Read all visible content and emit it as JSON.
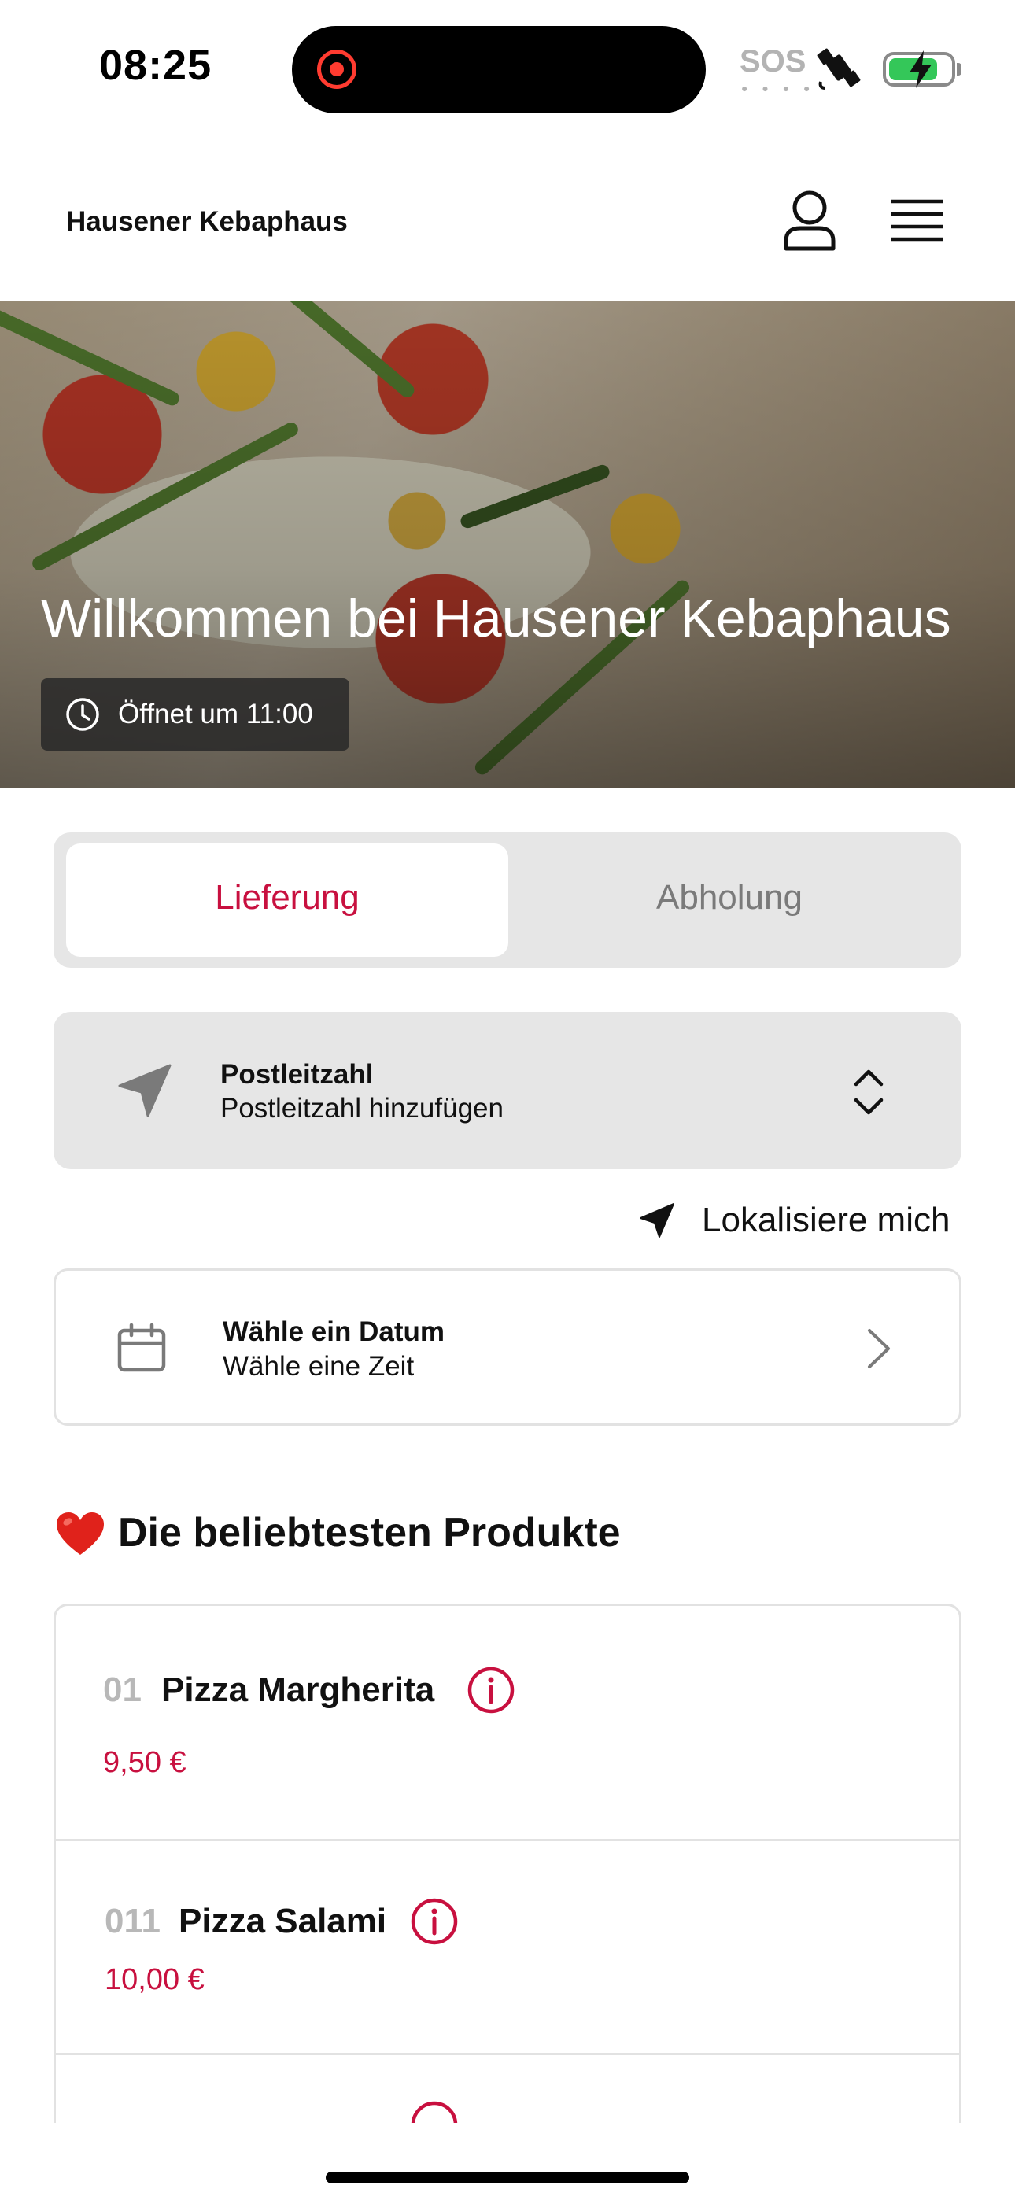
{
  "status_bar": {
    "time": "08:25",
    "sos": "SOS",
    "icons": [
      "screen-record-icon",
      "satellite-icon",
      "battery-charging-icon"
    ],
    "battery_level": 0.8
  },
  "header": {
    "brand": "Hausener Kebaphaus",
    "icons": [
      "user-icon",
      "menu-icon"
    ]
  },
  "hero": {
    "title": "Willkommen bei Hausener Kebaphaus",
    "opening": "Öffnet um 11:00",
    "opening_icon": "clock-icon"
  },
  "order_mode": {
    "options": [
      "Lieferung",
      "Abholung"
    ],
    "selected": "Lieferung"
  },
  "postal": {
    "title": "Postleitzahl",
    "placeholder": "Postleitzahl hinzufügen",
    "icon": "navigation-arrow-icon"
  },
  "locate": {
    "label": "Lokalisiere mich",
    "icon": "location-arrow-icon"
  },
  "schedule": {
    "title": "Wähle ein Datum",
    "subtitle": "Wähle eine Zeit",
    "icon": "calendar-icon"
  },
  "popular": {
    "title": "Die beliebtesten Produkte",
    "icon": "heart-emoji-icon",
    "products": [
      {
        "number": "01",
        "name": "Pizza Margherita",
        "price": "9,50 €"
      },
      {
        "number": "011",
        "name": "Pizza Salami",
        "price": "10,00 €"
      }
    ]
  },
  "colors": {
    "accent": "#c8103f",
    "panel": "#e6e6e6",
    "border": "#e2e2e2"
  }
}
